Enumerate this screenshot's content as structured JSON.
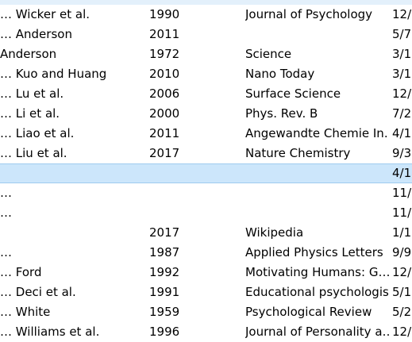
{
  "rows": [
    {
      "author": "… Wicker et al.",
      "year": "1990",
      "publication": "Journal of Psychology",
      "date": "12/",
      "selected": false
    },
    {
      "author": "… Anderson",
      "year": "2011",
      "publication": "",
      "date": "5/7",
      "selected": false
    },
    {
      "author": "  Anderson",
      "year": "1972",
      "publication": "Science",
      "date": "3/1",
      "selected": false
    },
    {
      "author": "… Kuo and Huang",
      "year": "2010",
      "publication": "Nano Today",
      "date": "3/1",
      "selected": false
    },
    {
      "author": "… Lu et al.",
      "year": "2006",
      "publication": "Surface Science",
      "date": "12/",
      "selected": false
    },
    {
      "author": "… Li et al.",
      "year": "2000",
      "publication": "Phys. Rev. B",
      "date": "7/2",
      "selected": false
    },
    {
      "author": "… Liao et al.",
      "year": "2011",
      "publication": "Angewandte Chemie In…",
      "date": "4/1",
      "selected": false
    },
    {
      "author": "… Liu et al.",
      "year": "2017",
      "publication": "Nature Chemistry",
      "date": "9/3",
      "selected": false
    },
    {
      "author": "",
      "year": "",
      "publication": "",
      "date": "4/1",
      "selected": true
    },
    {
      "author": "…",
      "year": "",
      "publication": "",
      "date": "11/",
      "selected": false
    },
    {
      "author": "…",
      "year": "",
      "publication": "",
      "date": "11/",
      "selected": false
    },
    {
      "author": "",
      "year": "2017",
      "publication": "Wikipedia",
      "date": "1/1",
      "selected": false
    },
    {
      "author": "…",
      "year": "1987",
      "publication": "Applied Physics Letters",
      "date": "9/9",
      "selected": false
    },
    {
      "author": "… Ford",
      "year": "1992",
      "publication": "Motivating Humans: G…",
      "date": "12/",
      "selected": false
    },
    {
      "author": "… Deci et al.",
      "year": "1991",
      "publication": "Educational psychologist",
      "date": "5/1",
      "selected": false
    },
    {
      "author": "… White",
      "year": "1959",
      "publication": "Psychological Review",
      "date": "5/2",
      "selected": false
    },
    {
      "author": "… Williams et al.",
      "year": "1996",
      "publication": "Journal of Personality a…",
      "date": "12/",
      "selected": false
    }
  ],
  "colors": {
    "selected_background": "#cce6fb",
    "selected_border": "#9fcbef",
    "text": "#000000"
  }
}
